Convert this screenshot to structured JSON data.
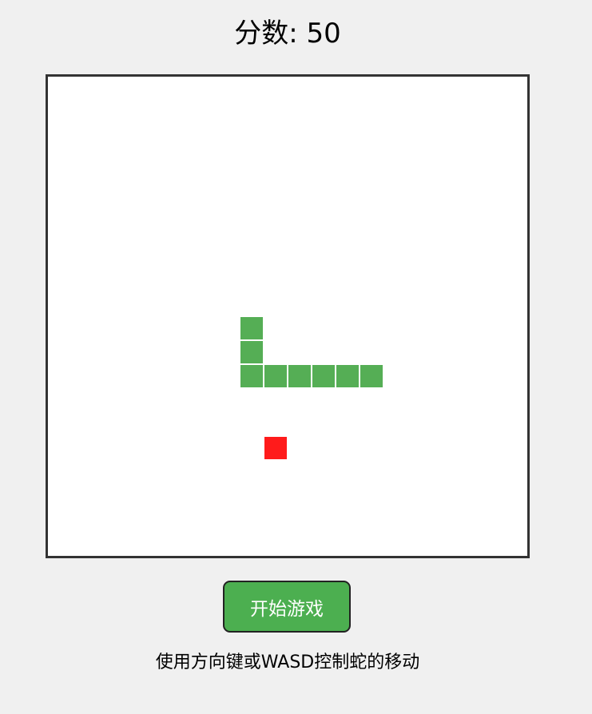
{
  "score": {
    "label": "分数:",
    "value": "50"
  },
  "board": {
    "grid_columns": 20,
    "grid_rows": 20,
    "snake": [
      [
        8,
        10
      ],
      [
        8,
        11
      ],
      [
        8,
        12
      ],
      [
        9,
        12
      ],
      [
        10,
        12
      ],
      [
        11,
        12
      ],
      [
        12,
        12
      ],
      [
        13,
        12
      ]
    ],
    "food": [
      9,
      15
    ],
    "snake_color": "#55ae55",
    "food_color": "#ff1b1b"
  },
  "controls": {
    "start_label": "开始游戏",
    "start_color": "#4caf50"
  },
  "hint": {
    "text": "使用方向键或WASD控制蛇的移动"
  }
}
